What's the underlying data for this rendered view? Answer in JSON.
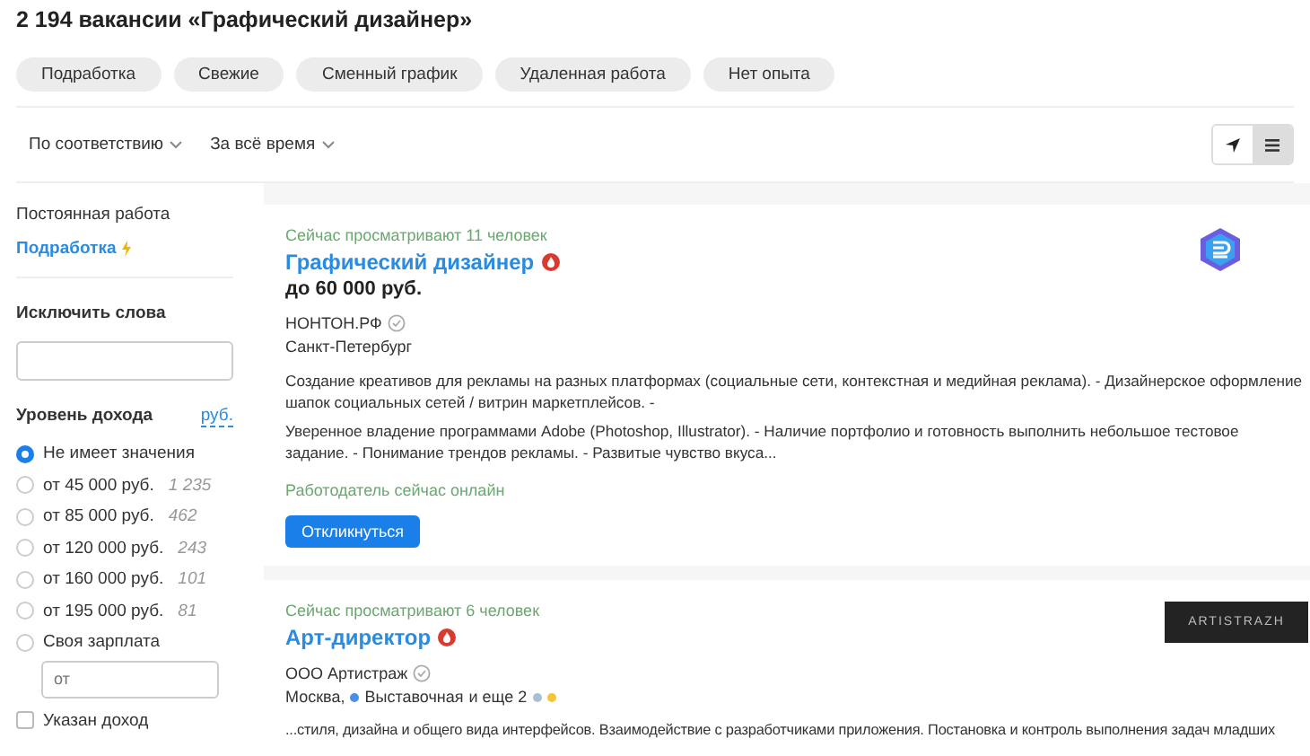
{
  "title": "2 194 вакансии «Графический дизайнер»",
  "chips": [
    {
      "label": "Подработка"
    },
    {
      "label": "Свежие"
    },
    {
      "label": "Сменный график"
    },
    {
      "label": "Удаленная работа"
    },
    {
      "label": "Нет опыта"
    }
  ],
  "sort": [
    {
      "label": "По соответствию"
    },
    {
      "label": "За всё время"
    }
  ],
  "view_toggle": [
    {
      "kind": "map",
      "selected": false
    },
    {
      "kind": "list",
      "selected": true
    }
  ],
  "sidebar": {
    "employment": {
      "label": "Постоянная работа",
      "link": "Подработка"
    },
    "exclude": {
      "label": "Исключить слова"
    },
    "income": {
      "label": "Уровень дохода",
      "currency": "руб.",
      "options": [
        {
          "label": "Не имеет значения",
          "selected": true
        },
        {
          "label": "от 45 000 руб.",
          "count": "1 235",
          "selected": false
        },
        {
          "label": "от 85 000 руб.",
          "count": "462",
          "selected": false
        },
        {
          "label": "от 120 000 руб.",
          "count": "243",
          "selected": false
        },
        {
          "label": "от 160 000 руб.",
          "count": "101",
          "selected": false
        },
        {
          "label": "от 195 000 руб.",
          "count": "81",
          "selected": false
        },
        {
          "label": "Своя зарплата",
          "selected": false
        }
      ],
      "custom_placeholder": "от",
      "specified": {
        "label": "Указан доход",
        "checked": false
      }
    }
  },
  "vacancies": [
    {
      "viewers": "Сейчас просматривают 11 человек",
      "title": "Графический дизайнер",
      "hot": true,
      "salary": "до 60 000 руб.",
      "company": "НОНТОН.РФ",
      "verified": true,
      "logo": {
        "kind": "hexagon"
      },
      "location": "Санкт-Петербург",
      "description": [
        "Создание креативов для рекламы на разных платформах (социальные сети, контекстная и медийная реклама). - Дизайнерское оформление шапок социальных сетей / витрин маркетплейсов. -",
        "Уверенное владение программами Adobe (Photoshop, Illustrator). - Наличие портфолио и готовность выполнить небольшое тестовое задание. - Понимание трендов рекламы. - Развитые чувство вкуса..."
      ],
      "online": "Работодатель сейчас онлайн",
      "button": "Откликнуться"
    },
    {
      "viewers": "Сейчас просматривают 6 человек",
      "title": "Арт-директор",
      "hot": true,
      "company": "ООО Артистраж",
      "verified": true,
      "logo": {
        "kind": "dark",
        "text": "ARTISTRAZH"
      },
      "location": "Москва,",
      "metro": [
        {
          "name": "Выставочная",
          "color": "#4a90e2"
        }
      ],
      "metro_more": "и еще 2",
      "metro_dots": [
        {
          "color": "#a9c0d3"
        },
        {
          "color": "#f4c534"
        }
      ],
      "description": [
        "...стиля, дизайна и общего вида интерфейсов. Взаимодействие с разработчиками приложения. Постановка и контроль выполнения задач младших"
      ]
    }
  ]
}
